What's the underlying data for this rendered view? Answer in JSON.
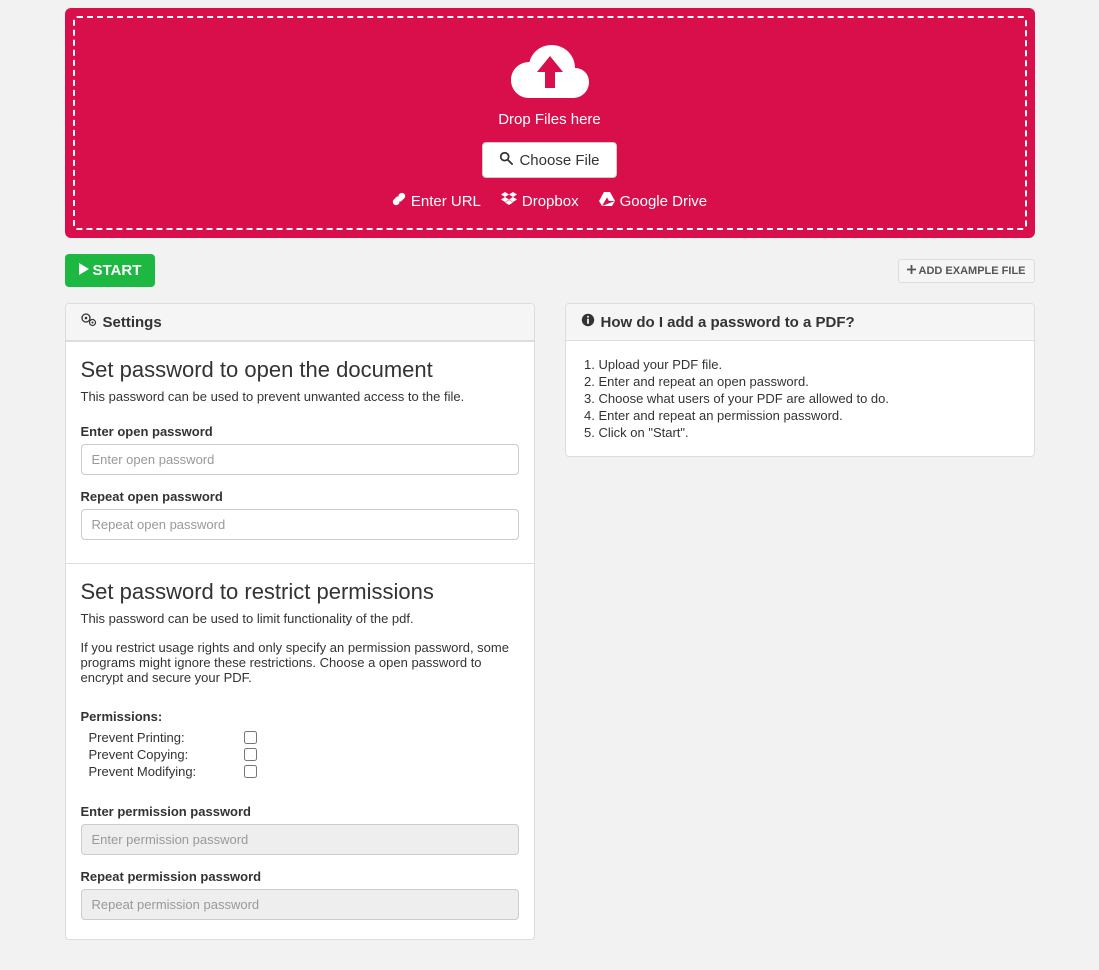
{
  "dropzone": {
    "drop_label": "Drop Files here",
    "choose_label": "Choose File",
    "enter_url": "Enter URL",
    "dropbox": "Dropbox",
    "google_drive": "Google Drive"
  },
  "actions": {
    "start": "START",
    "add_example": "ADD EXAMPLE FILE"
  },
  "settings_panel": {
    "title": "Settings"
  },
  "section_open": {
    "title": "Set password to open the document",
    "desc": "This password can be used to prevent unwanted access to the file.",
    "enter_label": "Enter open password",
    "enter_placeholder": "Enter open password",
    "repeat_label": "Repeat open password",
    "repeat_placeholder": "Repeat open password"
  },
  "section_perm": {
    "title": "Set password to restrict permissions",
    "desc": "This password can be used to limit functionality of the pdf.",
    "note": "If you restrict usage rights and only specify an permission password, some programs might ignore these restrictions. Choose a open password to encrypt and secure your PDF.",
    "permissions_label": "Permissions:",
    "prevent_printing": "Prevent Printing:",
    "prevent_copying": "Prevent Copying:",
    "prevent_modifying": "Prevent Modifying:",
    "enter_label": "Enter permission password",
    "enter_placeholder": "Enter permission password",
    "repeat_label": "Repeat permission password",
    "repeat_placeholder": "Repeat permission password"
  },
  "help_panel": {
    "title": "How do I add a password to a PDF?",
    "steps": [
      "Upload your PDF file.",
      "Enter and repeat an open password.",
      "Choose what users of your PDF are allowed to do.",
      "Enter and repeat an permission password.",
      "Click on \"Start\"."
    ]
  }
}
